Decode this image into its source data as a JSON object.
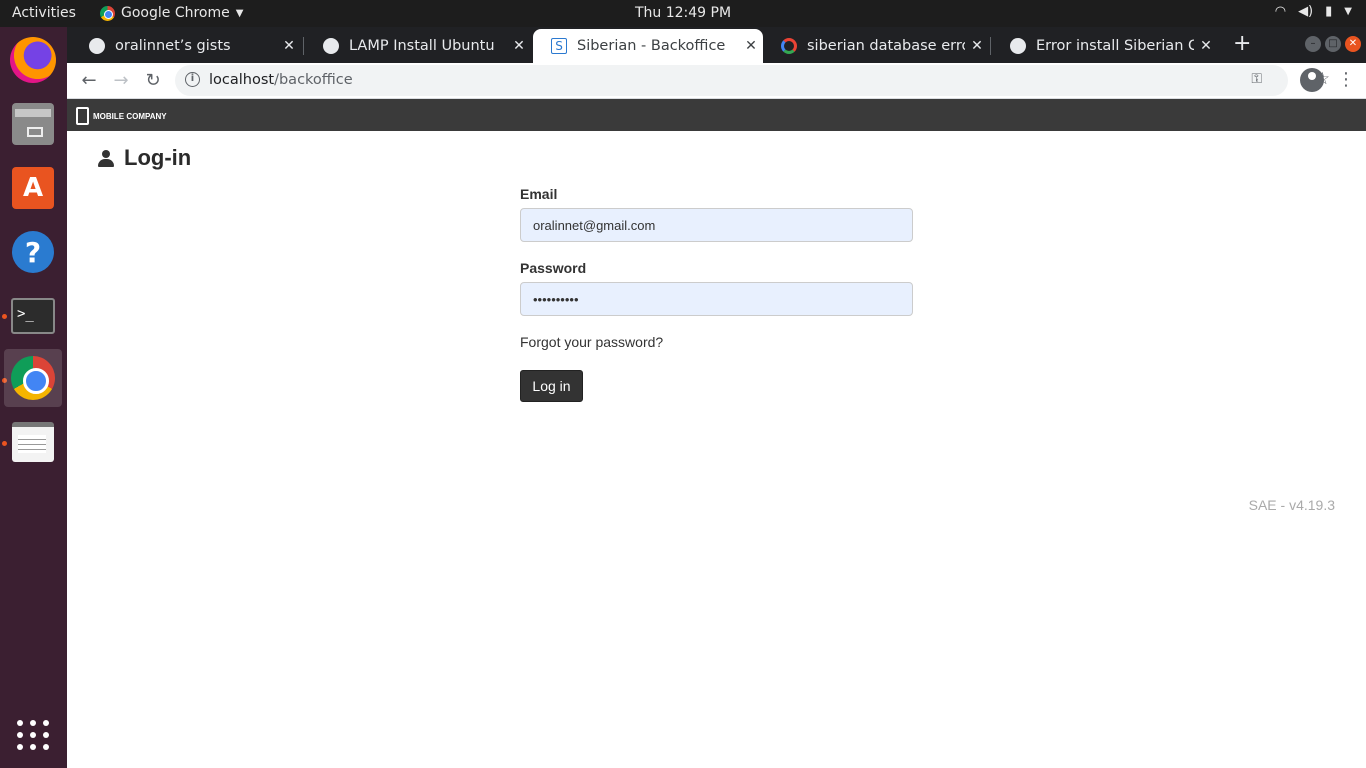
{
  "topbar": {
    "activities": "Activities",
    "app_name": "Google Chrome",
    "clock": "Thu 12:49 PM"
  },
  "dock": {
    "items": [
      "firefox-icon",
      "files-icon",
      "software-store-icon",
      "help-icon",
      "terminal-icon",
      "chrome-icon",
      "text-editor-icon",
      "app-grid-icon"
    ]
  },
  "browser": {
    "tabs": [
      {
        "title": "oralinnet’s gists",
        "icon": "github-icon"
      },
      {
        "title": "LAMP Install Ubuntu",
        "icon": "github-icon"
      },
      {
        "title": "Siberian - Backoffice",
        "icon": "siberian-icon",
        "active": true
      },
      {
        "title": "siberian database error",
        "icon": "google-icon"
      },
      {
        "title": "Error install Siberian CMS",
        "icon": "github-icon"
      }
    ],
    "url": {
      "host": "localhost",
      "path": "/backoffice"
    }
  },
  "site": {
    "logo_text": "MOBILE COMPANY"
  },
  "login": {
    "heading": "Log-in",
    "email_label": "Email",
    "email_value": "oralinnet@gmail.com",
    "password_label": "Password",
    "password_value": "••••••••••",
    "forgot": "Forgot your password?",
    "submit": "Log in"
  },
  "footer": {
    "version": "SAE - v4.19.3"
  },
  "colors": {
    "ubuntu_orange": "#e95420",
    "dock_bg": "#3b1f31",
    "site_header": "#3a3a3a",
    "input_autofill": "#e8f0fe"
  }
}
